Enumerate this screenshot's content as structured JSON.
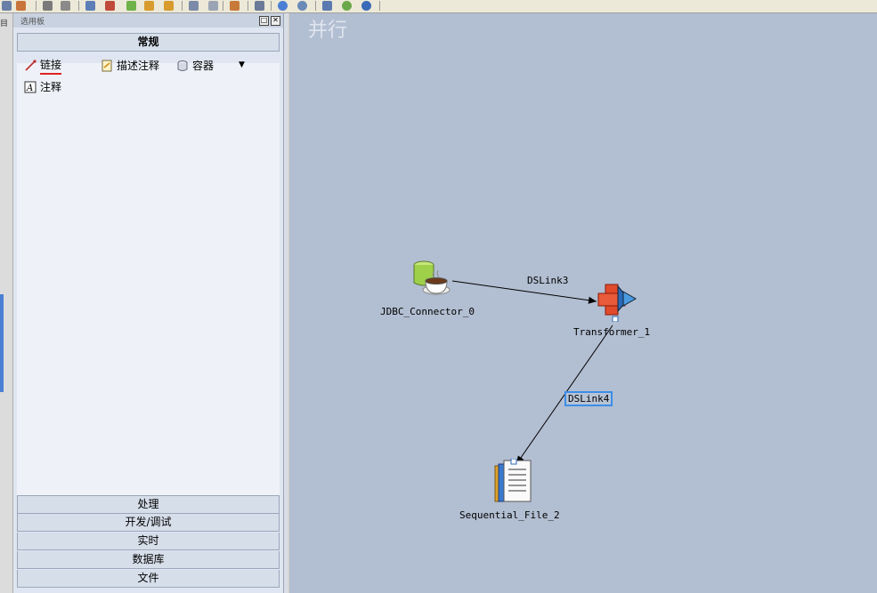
{
  "palette": {
    "title": "选用板",
    "general_header": "常规",
    "items": [
      {
        "label": "链接",
        "icon": "link-icon"
      },
      {
        "label": "描述注释",
        "icon": "description-annotation-icon"
      },
      {
        "label": "容器",
        "icon": "container-icon"
      },
      {
        "label": "注释",
        "icon": "annotation-icon"
      }
    ],
    "categories": [
      "处理",
      "开发/调试",
      "实时",
      "数据库",
      "文件"
    ]
  },
  "canvas": {
    "watermark": "并行",
    "stages": [
      {
        "name": "JDBC_Connector_0",
        "icon": "jdbc-connector-icon"
      },
      {
        "name": "Transformer_1",
        "icon": "transformer-icon"
      },
      {
        "name": "Sequential_File_2",
        "icon": "sequential-file-icon"
      }
    ],
    "links": [
      {
        "name": "DSLink3",
        "selected": false
      },
      {
        "name": "DSLink4",
        "selected": true
      }
    ]
  },
  "colors": {
    "canvas_bg": "#b2bed1",
    "palette_bg": "#dfe6f1",
    "selection": "#3c8ee8"
  }
}
